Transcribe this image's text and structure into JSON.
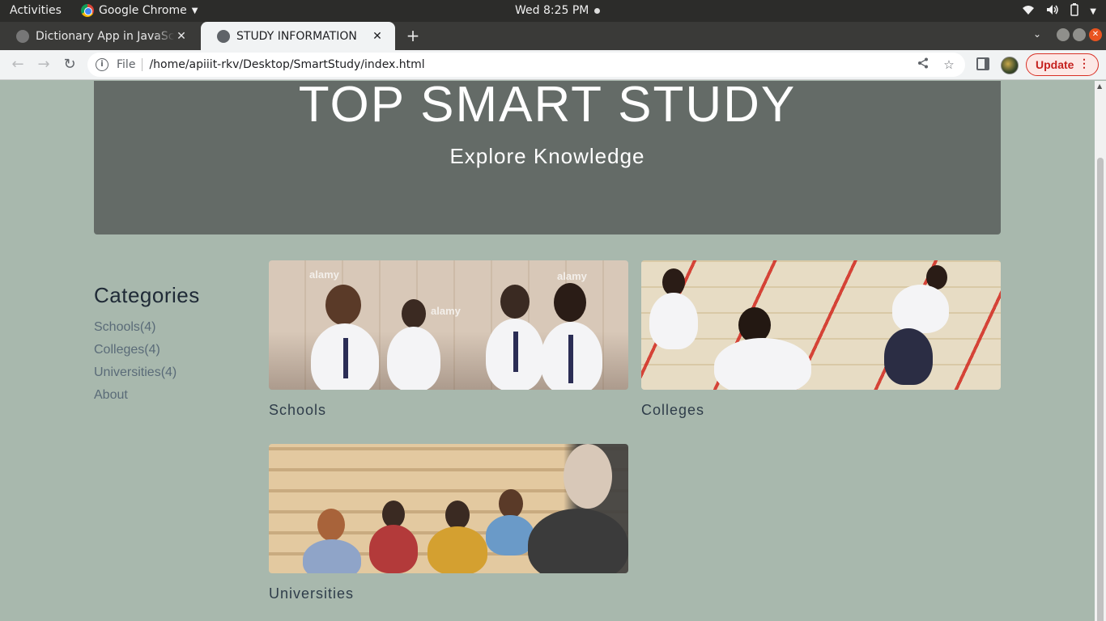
{
  "os": {
    "activities": "Activities",
    "app_name": "Google Chrome",
    "clock": "Wed  8:25 PM"
  },
  "browser": {
    "tabs": [
      {
        "title": "Dictionary App in JavaScript"
      },
      {
        "title": "STUDY INFORMATION"
      }
    ],
    "address": {
      "scheme_label": "File",
      "url": "/home/apiiit-rkv/Desktop/SmartStudy/index.html"
    },
    "update_label": "Update"
  },
  "page": {
    "hero": {
      "title": "TOP SMART STUDY",
      "subtitle": "Explore Knowledge"
    },
    "sidebar": {
      "heading": "Categories",
      "items": [
        {
          "label": "Schools(4)"
        },
        {
          "label": "Colleges(4)"
        },
        {
          "label": "Universities(4)"
        },
        {
          "label": "About"
        }
      ]
    },
    "cards": [
      {
        "caption": "Schools",
        "image": "school-students-raising-hands-photo"
      },
      {
        "caption": "Colleges",
        "image": "students-writing-exam-photo"
      },
      {
        "caption": "Universities",
        "image": "lecture-hall-students-photo"
      }
    ]
  },
  "colors": {
    "page_bg": "#a8b8ad",
    "hero_bg": "#646b67",
    "update_red": "#c5221f"
  }
}
